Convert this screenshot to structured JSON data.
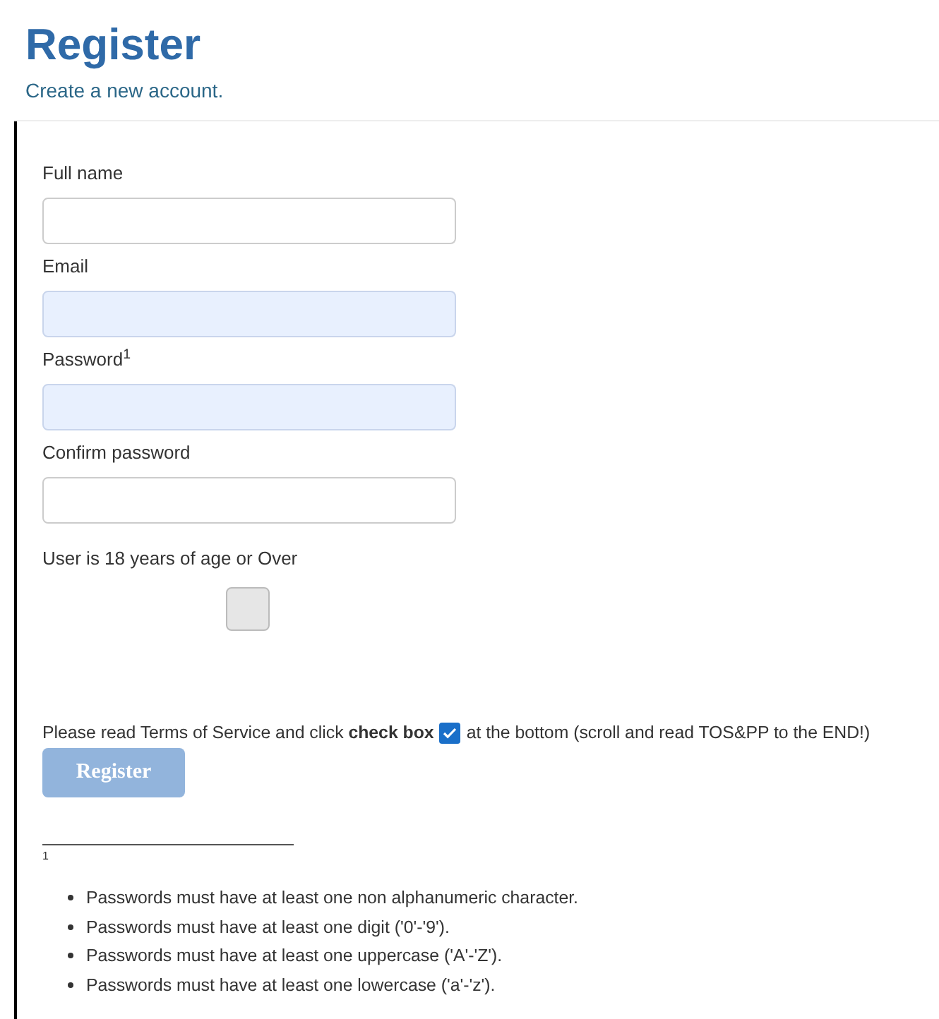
{
  "page": {
    "title": "Register",
    "subtitle": "Create a new account."
  },
  "fields": [
    {
      "label": "Full name",
      "autofilled": false
    },
    {
      "label": "Email",
      "autofilled": true
    },
    {
      "label": "Password$^{1}$",
      "autofilled": true
    },
    {
      "label": "Confirm password",
      "autofilled": false
    }
  ],
  "age_check": {
    "label": "User is 18 years of age or Over",
    "checked": false
  },
  "notice": {
    "before": "Please read Terms of Service and click **check box**",
    "after": "at the bottom (scroll and read TOS&PP to the END!)"
  },
  "register_button": {
    "label": "Register",
    "disabled": true
  },
  "footnote": {
    "mark": "1",
    "items": [
      "Passwords must have at least one non alphanumeric character.",
      "Passwords must have at least one digit ('0'-'9').",
      "Passwords must have at least one uppercase ('A'-'Z').",
      "Passwords must have at least one lowercase ('a'-'z')."
    ]
  }
}
